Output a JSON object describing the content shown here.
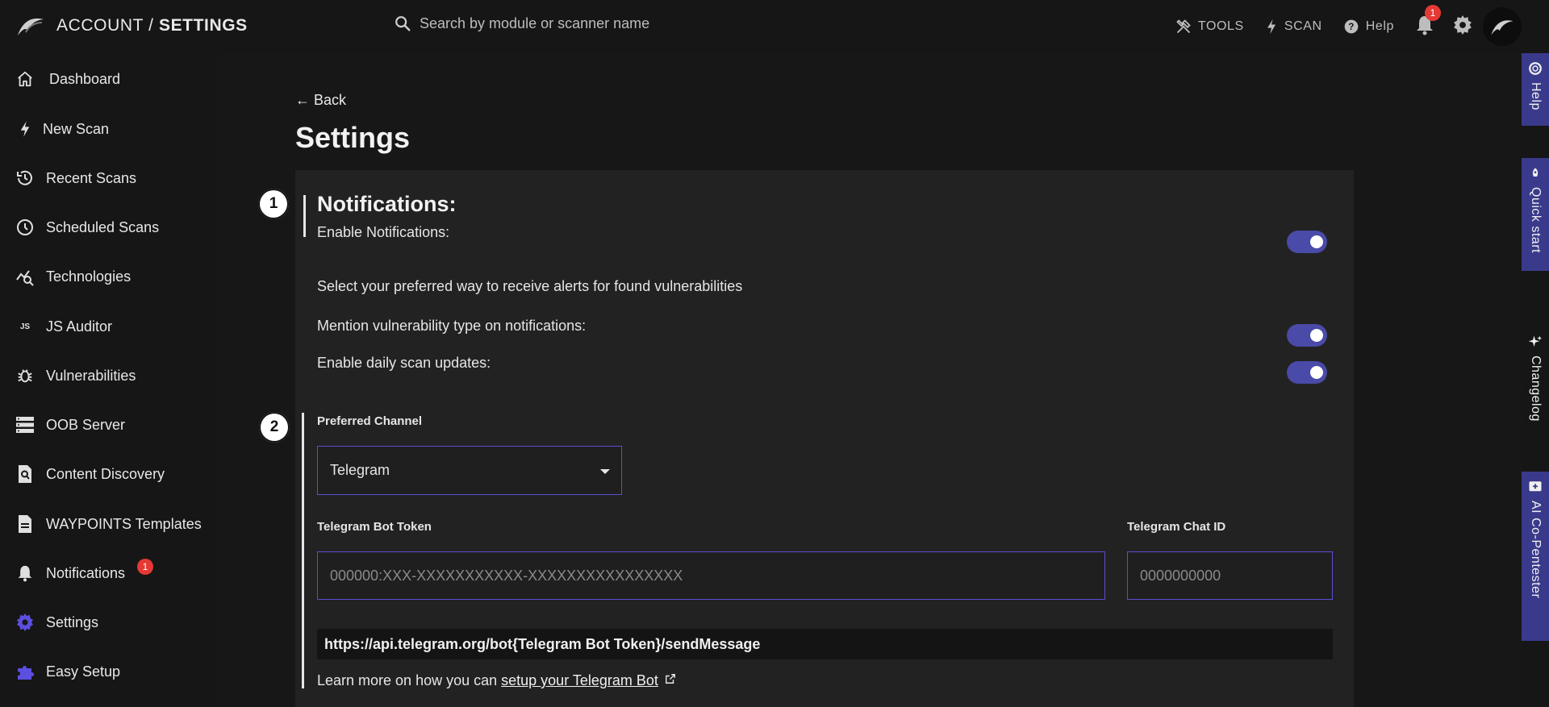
{
  "header": {
    "breadcrumb_account": "ACCOUNT /",
    "breadcrumb_settings": "SETTINGS",
    "search_placeholder": "Search by module or scanner name",
    "tools_label": "TOOLS",
    "scan_label": "SCAN",
    "help_label": "Help",
    "notification_count": "1"
  },
  "sidebar": {
    "items": [
      {
        "label": "Dashboard",
        "icon": "home-icon"
      },
      {
        "label": "New Scan",
        "icon": "bolt-icon"
      },
      {
        "label": "Recent Scans",
        "icon": "history-icon"
      },
      {
        "label": "Scheduled Scans",
        "icon": "clock-icon"
      },
      {
        "label": "Technologies",
        "icon": "chart-search-icon"
      },
      {
        "label": "JS Auditor",
        "icon": "js-icon"
      },
      {
        "label": "Vulnerabilities",
        "icon": "bug-icon"
      },
      {
        "label": "OOB Server",
        "icon": "server-icon"
      },
      {
        "label": "Content Discovery",
        "icon": "file-search-icon"
      },
      {
        "label": "WAYPOINTS Templates",
        "icon": "document-icon"
      },
      {
        "label": "Notifications",
        "icon": "bell-icon",
        "badge": "1"
      },
      {
        "label": "Settings",
        "icon": "gear-icon"
      },
      {
        "label": "Easy Setup",
        "icon": "puzzle-icon"
      }
    ],
    "accent_color": "#5b4fe0"
  },
  "rail": {
    "help": "Help",
    "quick_start": "Quick start",
    "changelog": "Changelog",
    "ai_copentester": "AI Co-Pentester"
  },
  "main": {
    "back_label": "← Back",
    "title": "Settings",
    "section1": {
      "step": "1",
      "heading": "Notifications:",
      "enable_label": "Enable Notifications:",
      "enable_value": true,
      "description": "Select your preferred way to receive alerts for found vulnerabilities",
      "mention_label": "Mention vulnerability type on notifications:",
      "mention_value": true,
      "daily_label": "Enable daily scan updates:",
      "daily_value": true
    },
    "section2": {
      "step": "2",
      "channel_label": "Preferred Channel",
      "channel_value": "Telegram",
      "token_label": "Telegram Bot Token",
      "token_placeholder": "000000:XXX-XXXXXXXXXXX-XXXXXXXXXXXXXXXX",
      "chat_label": "Telegram Chat ID",
      "chat_placeholder": "0000000000",
      "api_url": "https://api.telegram.org/bot{Telegram Bot Token}/sendMessage",
      "learn_prefix": "Learn more on how you can ",
      "learn_link": "setup your Telegram Bot"
    }
  }
}
